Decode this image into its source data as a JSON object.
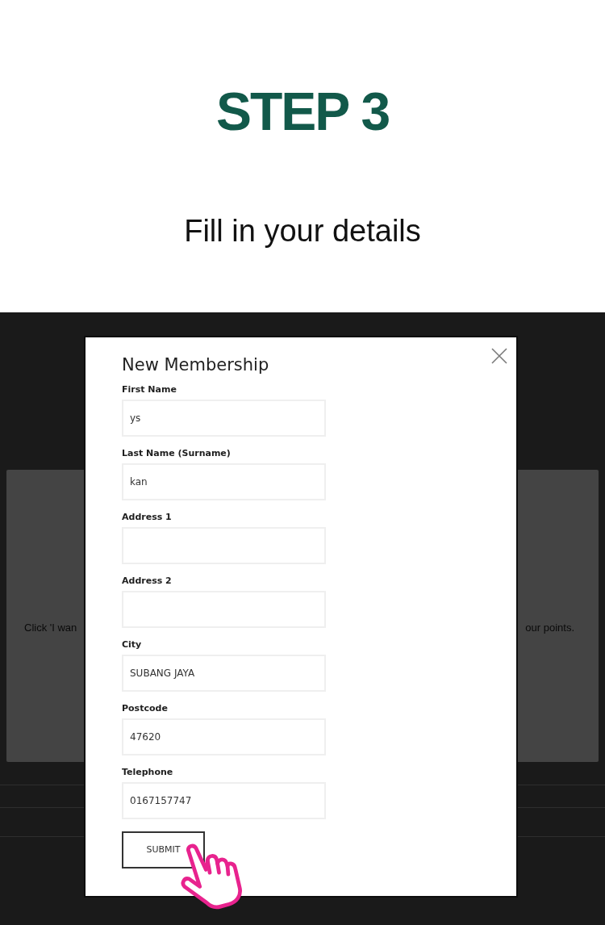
{
  "header": {
    "title": "STEP 3",
    "subtitle": "Fill in your details"
  },
  "background_page": {
    "panel_texts": [
      "Click 'I wan",
      "our points."
    ]
  },
  "modal": {
    "title": "New Membership",
    "fields": [
      {
        "label": "First Name",
        "value": "ys"
      },
      {
        "label": "Last Name (Surname)",
        "value": "kan"
      },
      {
        "label": "Address 1"
      },
      {
        "label": "Address 2"
      },
      {
        "label": "City",
        "value": "SUBANG JAYA"
      },
      {
        "label": "Postcode",
        "value": "47620"
      },
      {
        "label": "Telephone",
        "value": "0167157747"
      }
    ],
    "submit": "SUBMIT"
  }
}
